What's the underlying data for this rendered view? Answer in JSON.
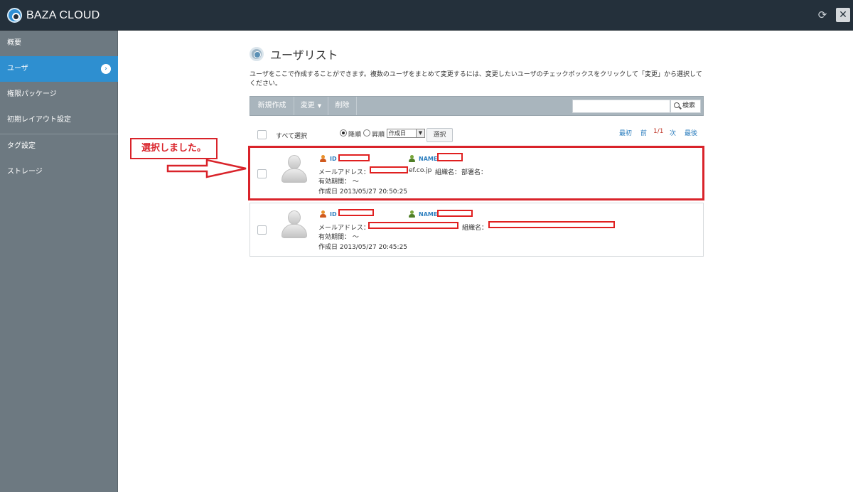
{
  "app": {
    "title": "BAZA CLOUD",
    "icons": {
      "logo": "cloud-logo-icon",
      "refresh": "refresh-icon",
      "close": "close-icon"
    }
  },
  "sidebar": {
    "items": [
      {
        "label": "概要"
      },
      {
        "label": "ユーザ",
        "active": true
      },
      {
        "label": "権限パッケージ"
      },
      {
        "label": "初期レイアウト設定"
      },
      {
        "label": "タグ設定"
      },
      {
        "label": "ストレージ"
      }
    ]
  },
  "main": {
    "title": "ユーザリスト",
    "description": "ユーザをここで作成することができます。複数のユーザをまとめて変更するには、変更したいユーザのチェックボックスをクリックして「変更」から選択してください。",
    "toolbar": {
      "new": "新規作成",
      "change": "変更",
      "delete": "削除",
      "search_placeholder": "",
      "search_button": "検索"
    },
    "controls": {
      "select_all": "すべて選択",
      "sort_desc": "降順",
      "sort_asc": "昇順",
      "sort_desc_checked": true,
      "sort_field": "作成日",
      "select_button": "選択"
    },
    "pager": {
      "first": "最初",
      "prev": "前",
      "current": "1/1",
      "next": "次",
      "last": "最後"
    },
    "users": [
      {
        "id_label": "ID",
        "name_label": "NAME",
        "email_label": "メールアドレス：",
        "email_suffix": "ef.co.jp",
        "org_label": "組織名：",
        "dept_label": "部署名：",
        "validity": "有効期間： ～",
        "created": "作成日 2013/05/27 20:50:25",
        "selected": true
      },
      {
        "id_label": "ID",
        "name_label": "NAME",
        "email_label": "メールアドレス：",
        "email_suffix": "",
        "org_label": "組織名：",
        "dept_label": "",
        "validity": "有効期間： ～",
        "created": "作成日 2013/05/27 20:45:25",
        "selected": false
      }
    ]
  },
  "annotation": {
    "callout": "選択しました。",
    "color": "#d9232a"
  },
  "colors": {
    "topbar": "#24303b",
    "sidebar": "#6d7981",
    "sidebar_active": "#2e8fd0",
    "toolbar": "#a9b5bd",
    "link": "#2e7fbf"
  }
}
